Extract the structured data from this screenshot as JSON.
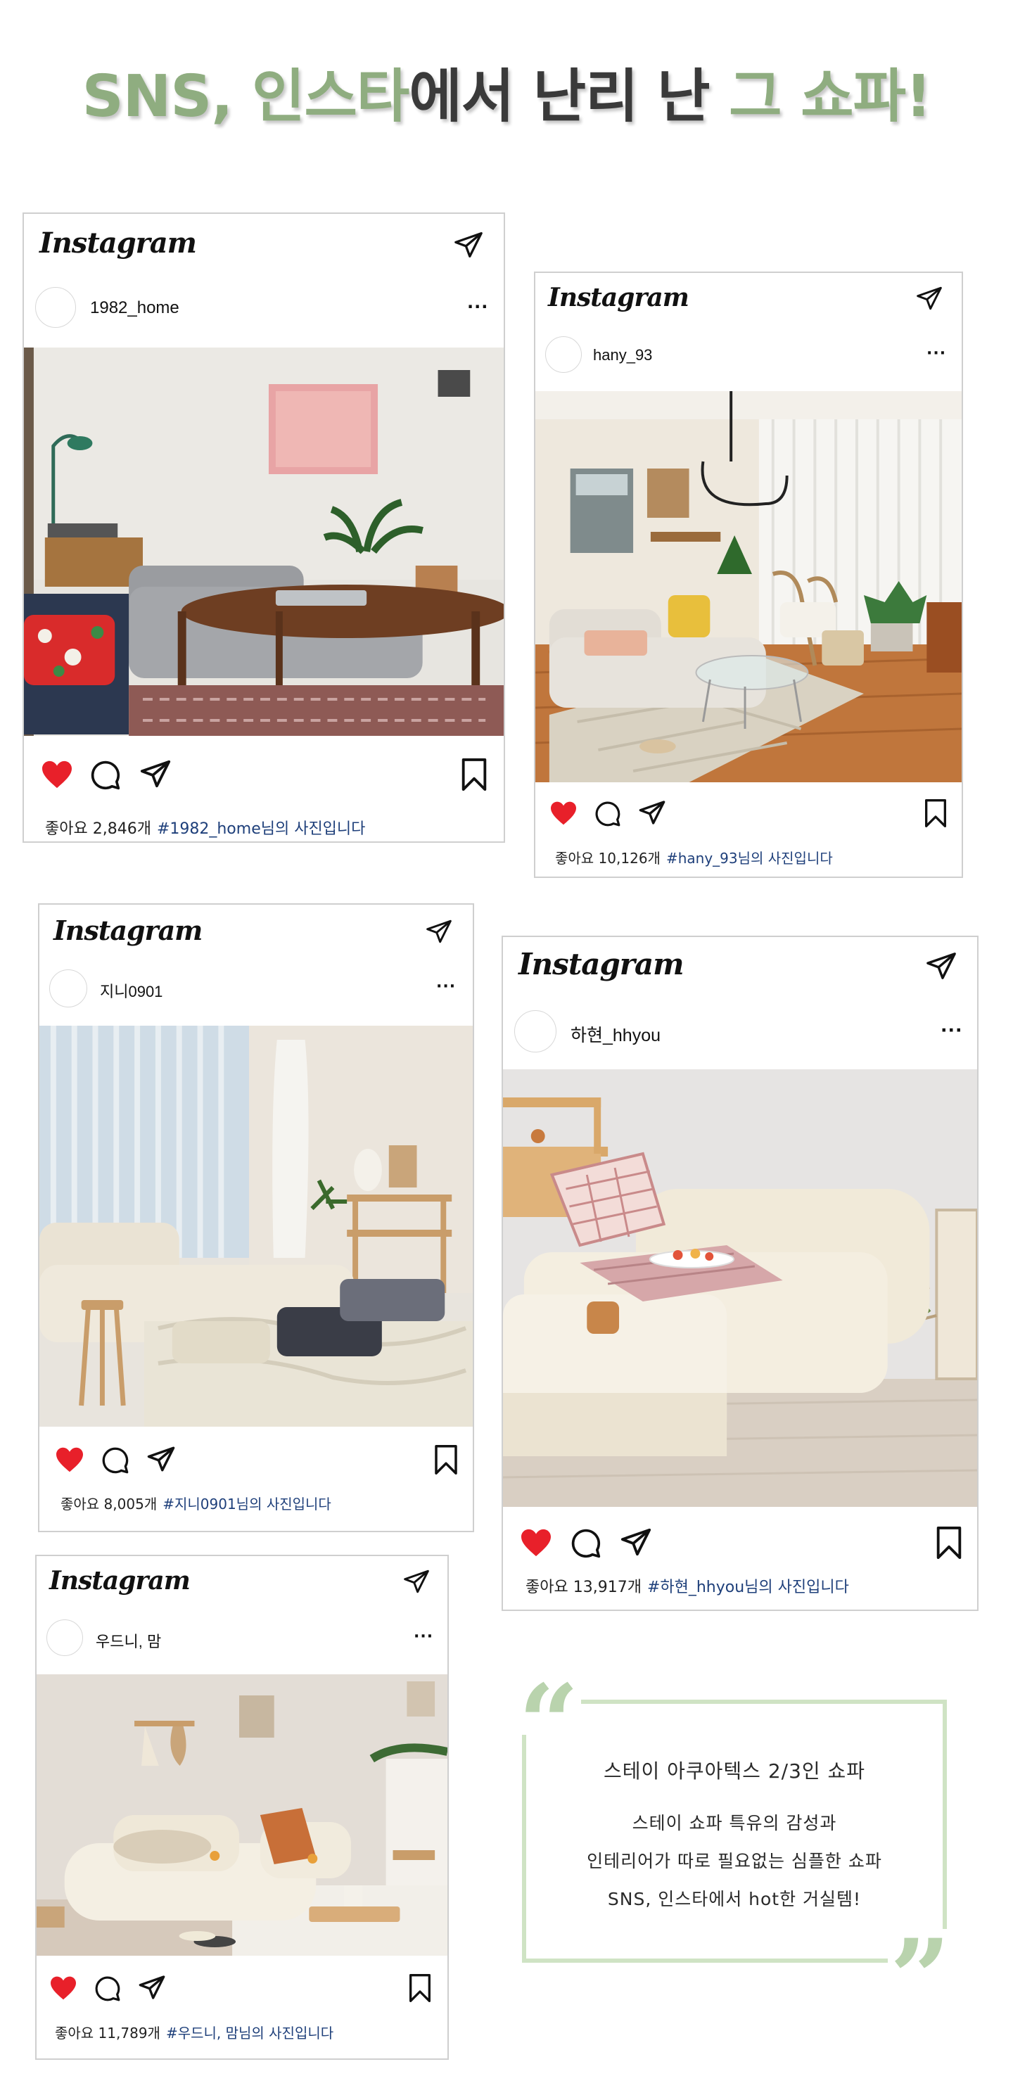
{
  "headline": {
    "part1": "SNS, 인스타",
    "part2": "에서 난리 난 ",
    "part3": "그 쇼파!"
  },
  "colors": {
    "accent_green": "#8fad80",
    "heart_red": "#e8202a",
    "hashtag_blue": "#1e3f7a",
    "quote_frame": "#cfe3c4"
  },
  "posts": [
    {
      "logo": "Instagram",
      "username": "1982_home",
      "more": "···",
      "likes": "좋아요 2,846개",
      "hashtag": "#1982_home님의 사진입니다",
      "liked": true
    },
    {
      "logo": "Instagram",
      "username": "hany_93",
      "more": "···",
      "likes": "좋아요 10,126개",
      "hashtag": "#hany_93님의 사진입니다",
      "liked": true
    },
    {
      "logo": "Instagram",
      "username": "지니0901",
      "more": "···",
      "likes": "좋아요 8,005개",
      "hashtag": "#지니0901님의 사진입니다",
      "liked": true
    },
    {
      "logo": "Instagram",
      "username": "하현_hhyou",
      "more": "···",
      "likes": "좋아요 13,917개",
      "hashtag": "#하현_hhyou님의 사진입니다",
      "liked": true
    },
    {
      "logo": "Instagram",
      "username": "우드니, 맘",
      "more": "···",
      "likes": "좋아요 11,789개",
      "hashtag": "#우드니, 맘님의 사진입니다",
      "liked": true
    }
  ],
  "icons": {
    "like": "heart-icon",
    "comment": "comment-icon",
    "share": "send-icon",
    "save": "bookmark-icon",
    "direct": "direct-message-icon"
  },
  "quote": {
    "open_mark": "“",
    "close_mark": "”",
    "title": "스테이 아쿠아텍스 2/3인 쇼파",
    "lines": [
      "스테이 쇼파 특유의 감성과",
      "인테리어가 따로 필요없는 심플한 쇼파",
      "SNS, 인스타에서 hot한 거실템!"
    ]
  }
}
